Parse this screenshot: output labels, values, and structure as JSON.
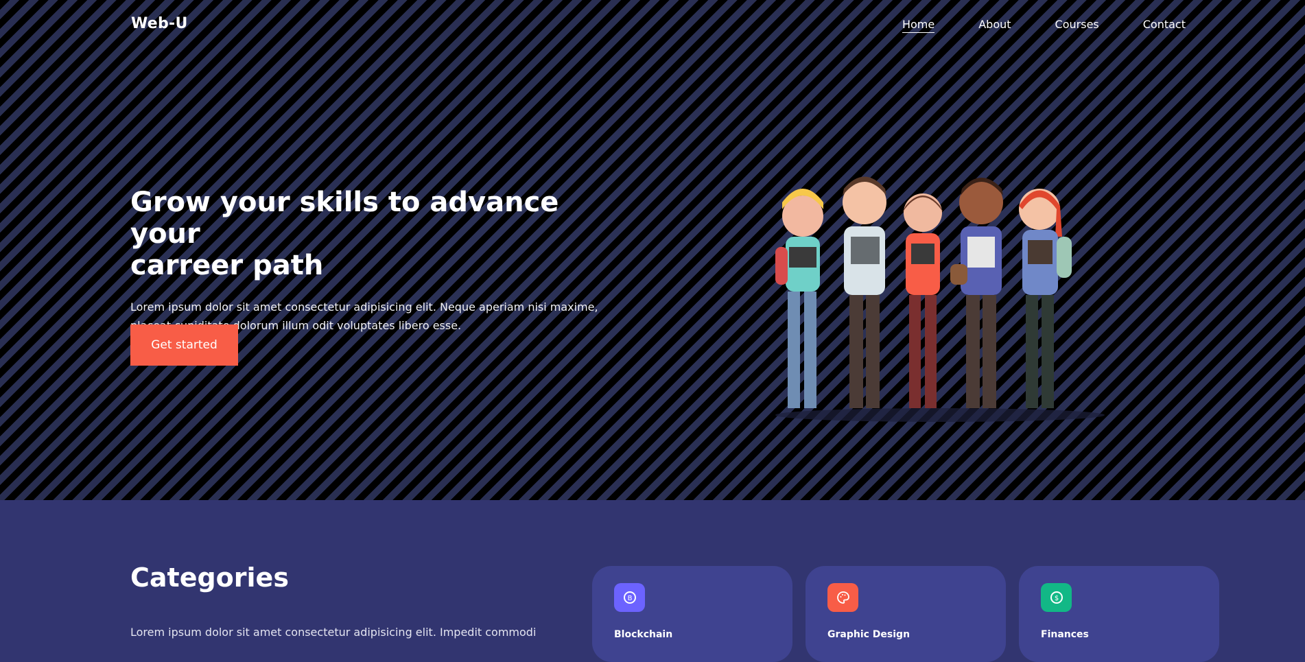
{
  "header": {
    "logo": "Web-U",
    "nav": [
      {
        "label": "Home",
        "active": true
      },
      {
        "label": "About"
      },
      {
        "label": "Courses"
      },
      {
        "label": "Contact"
      }
    ]
  },
  "hero": {
    "title_line1": "Grow your skills to advance your",
    "title_line2": "carreer path",
    "desc_line1": "Lorem ipsum dolor sit amet consectetur adipisicing elit. Neque aperiam nisi maxime,",
    "desc_line2": "placeat cupiditate dolorum illum odit voluptates libero esse.",
    "cta_label": "Get started"
  },
  "categories": {
    "title": "Categories",
    "desc": "Lorem ipsum dolor sit amet consectetur adipisicing elit. Impedit commodi",
    "cards": [
      {
        "label": "Blockchain",
        "icon": "bitcoin-icon",
        "color": "#6c63ff"
      },
      {
        "label": "Graphic Design",
        "icon": "palette-icon",
        "color": "#f85d47"
      },
      {
        "label": "Finances",
        "icon": "dollar-icon",
        "color": "#12b886"
      }
    ]
  },
  "colors": {
    "accent": "#f85d47",
    "section_bg": "#323570",
    "card_bg": "#3f4390"
  }
}
